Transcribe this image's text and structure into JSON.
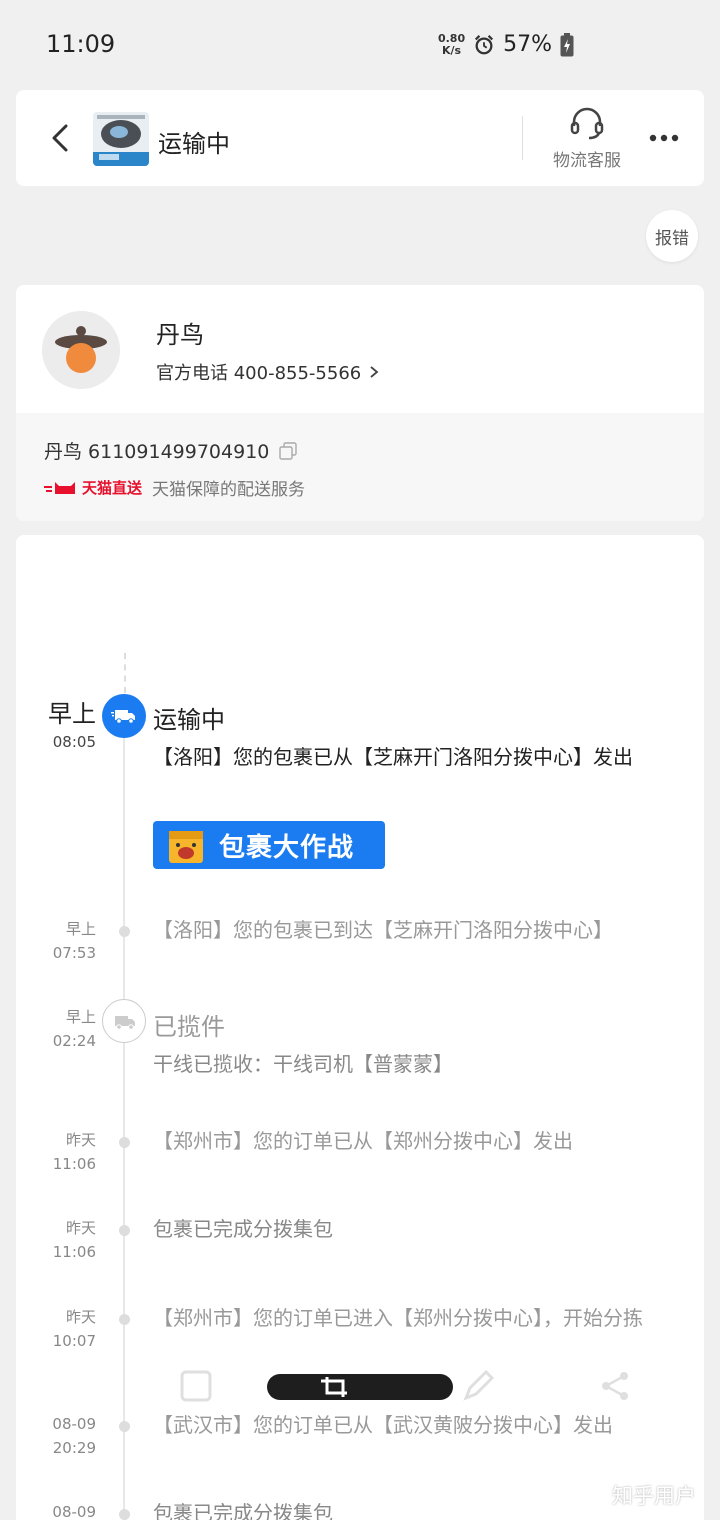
{
  "status_bar": {
    "time": "11:09",
    "net_speed_value": "0.80",
    "net_speed_unit": "K/s",
    "battery": "57%"
  },
  "header": {
    "title": "运输中",
    "customer_service_label": "物流客服"
  },
  "report_label": "报错",
  "courier": {
    "name": "丹鸟",
    "phone_label": "官方电话 400-855-5566",
    "tracking": "丹鸟 611091499704910",
    "badge_label": "天猫直送",
    "service_text": "天猫保障的配送服务"
  },
  "timeline": [
    {
      "date": "早上",
      "time": "08:05",
      "status": "运输中",
      "text": "【洛阳】您的包裹已从【芝麻开门洛阳分拨中心】发出",
      "promo": "包裹大作战"
    },
    {
      "date": "早上",
      "time": "07:53",
      "text": "【洛阳】您的包裹已到达【芝麻开门洛阳分拨中心】"
    },
    {
      "date": "早上",
      "time": "02:24",
      "status": "已揽件",
      "text": "干线已揽收：干线司机【普蒙蒙】"
    },
    {
      "date": "昨天",
      "time": "11:06",
      "text": "【郑州市】您的订单已从【郑州分拨中心】发出"
    },
    {
      "date": "昨天",
      "time": "11:06",
      "text": "包裹已完成分拨集包"
    },
    {
      "date": "昨天",
      "time": "10:07",
      "text": "【郑州市】您的订单已进入【郑州分拨中心】，开始分拣"
    },
    {
      "date": "08-09",
      "time": "20:29",
      "text": "【武汉市】您的订单已从【武汉黄陂分拨中心】发出"
    },
    {
      "date": "08-09",
      "time": "",
      "text": "包裹已完成分拨集包"
    }
  ],
  "watermark": "知乎用户",
  "colors": {
    "accent": "#1a7cf0",
    "tmall_red": "#e8112d",
    "background": "#f0f0f0"
  }
}
